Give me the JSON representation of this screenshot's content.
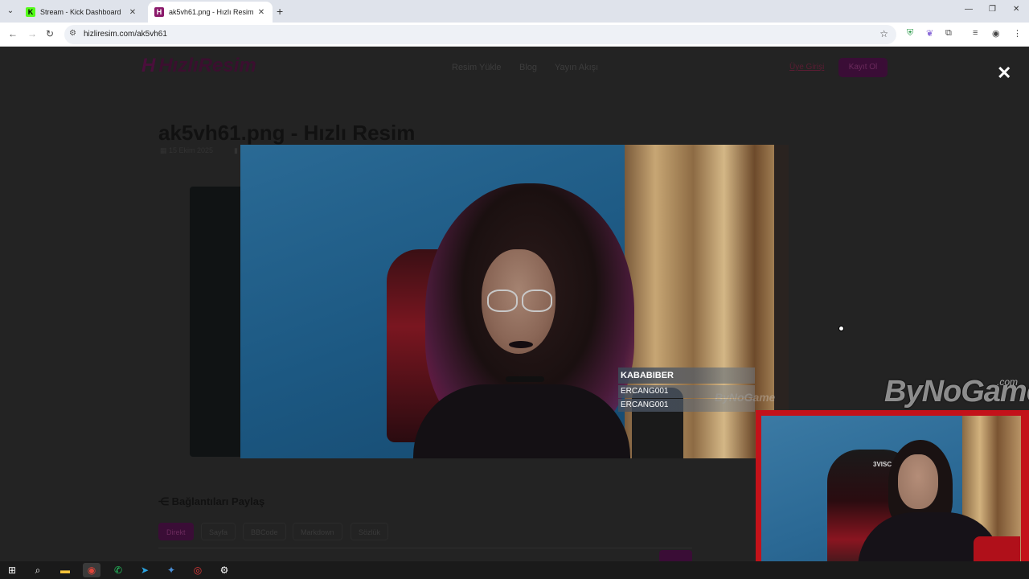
{
  "browser": {
    "tabs": [
      {
        "title": "Stream - Kick Dashboard",
        "favicon": "kick-icon",
        "active": false
      },
      {
        "title": "ak5vh61.png - Hızlı Resim",
        "favicon": "hizliresim-icon",
        "active": true
      }
    ],
    "url": "hizliresim.com/ak5vh61"
  },
  "site": {
    "logo_text": "HızlıResim",
    "nav": [
      "Resim Yükle",
      "Blog",
      "Yayın Akışı"
    ],
    "login": "Üye Girişi",
    "register": "Kayıt Ol",
    "page_title": "ak5vh61.png - Hızlı Resim",
    "date": "15 Ekim 2025",
    "share_title": "Bağlantıları Paylaş",
    "share_tabs": [
      "Direkt",
      "Sayfa",
      "BBCode",
      "Markdown",
      "Sözlük"
    ]
  },
  "stream_overlay": {
    "chat": [
      "KABABIBER",
      "ERCANG001",
      "ERCANG001"
    ],
    "brand": "ByNoGame",
    "brand_suffix": ".com",
    "viewer_watermark": "ByNoGame",
    "chair_brand": "3VISC"
  },
  "colors": {
    "accent": "#3a0d36",
    "cam_border": "#c3121a"
  }
}
